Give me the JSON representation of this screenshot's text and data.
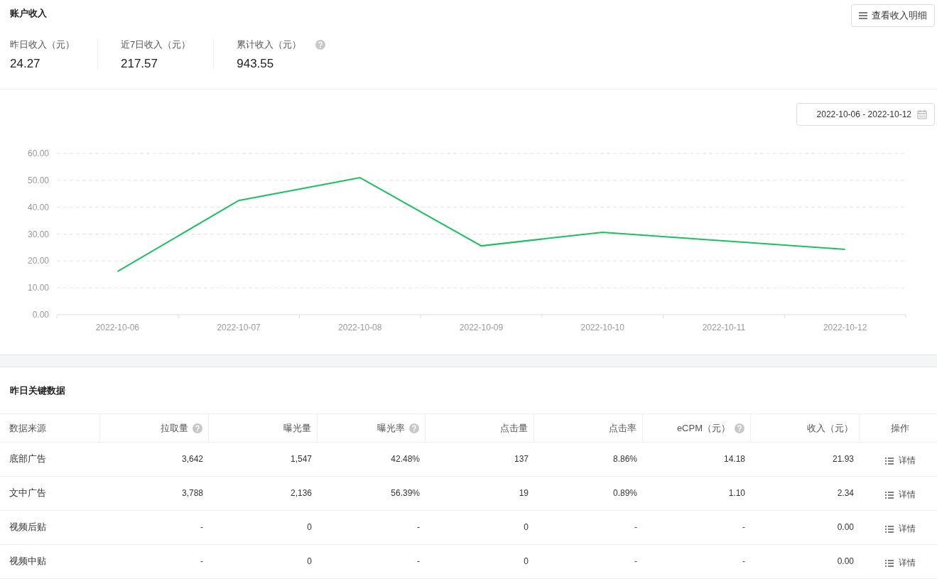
{
  "account": {
    "title": "账户收入",
    "detail_button": "查看收入明细",
    "stats": [
      {
        "label": "昨日收入（元）",
        "value": "24.27",
        "help": false
      },
      {
        "label": "近7日收入（元）",
        "value": "217.57",
        "help": false
      },
      {
        "label": "累计收入（元）",
        "value": "943.55",
        "help": true
      }
    ]
  },
  "trend": {
    "date_range": "2022-10-06 - 2022-10-12",
    "chart_data": {
      "type": "line",
      "categories": [
        "2022-10-06",
        "2022-10-07",
        "2022-10-08",
        "2022-10-09",
        "2022-10-10",
        "2022-10-11",
        "2022-10-12"
      ],
      "series": [
        {
          "color": "#19c15f",
          "values": [
            16.1,
            42.5,
            51.0,
            25.6,
            30.7,
            27.5,
            24.3
          ]
        }
      ],
      "grid": true,
      "ylim": [
        0,
        60
      ],
      "yticks": [
        {
          "value": 0,
          "label": "0.00"
        },
        {
          "value": 10,
          "label": "10.00"
        },
        {
          "value": 20,
          "label": "20.00"
        },
        {
          "value": 30,
          "label": "30.00"
        },
        {
          "value": 40,
          "label": "40.00"
        },
        {
          "value": 50,
          "label": "50.00"
        },
        {
          "value": 60,
          "label": "60.00"
        }
      ]
    }
  },
  "key_data": {
    "title": "昨日关键数据",
    "table": {
      "columns": [
        {
          "label": "数据来源",
          "help": false
        },
        {
          "label": "拉取量",
          "help": true
        },
        {
          "label": "曝光量",
          "help": false
        },
        {
          "label": "曝光率",
          "help": true
        },
        {
          "label": "点击量",
          "help": false
        },
        {
          "label": "点击率",
          "help": false
        },
        {
          "label": "eCPM（元）",
          "help": true
        },
        {
          "label": "收入（元）",
          "help": false
        },
        {
          "label": "操作",
          "help": false
        }
      ],
      "rows": [
        {
          "cells": [
            "底部广告",
            "3,642",
            "1,547",
            "42.48%",
            "137",
            "8.86%",
            "14.18",
            "21.93"
          ],
          "action": "详情"
        },
        {
          "cells": [
            "文中广告",
            "3,788",
            "2,136",
            "56.39%",
            "19",
            "0.89%",
            "1.10",
            "2.34"
          ],
          "action": "详情"
        },
        {
          "cells": [
            "视频后贴",
            "-",
            "0",
            "-",
            "0",
            "-",
            "-",
            "0.00"
          ],
          "action": "详情"
        },
        {
          "cells": [
            "视频中贴",
            "-",
            "0",
            "-",
            "0",
            "-",
            "-",
            "0.00"
          ],
          "action": "详情"
        }
      ]
    }
  }
}
